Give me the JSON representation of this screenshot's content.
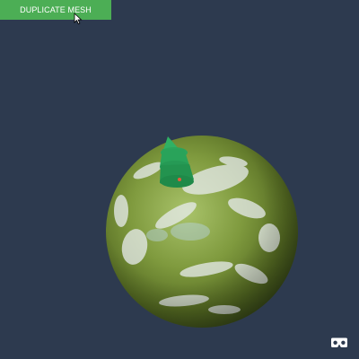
{
  "toolbar": {
    "duplicate_label": "DUPLICATE MESH"
  },
  "scene": {
    "background_color": "#2d3a4f",
    "button_color": "#4cae55",
    "globe_icon": "textured-planet-sphere",
    "tree_icon": "green-cone-tree-mesh",
    "vr_icon": "vr-headset-icon"
  }
}
